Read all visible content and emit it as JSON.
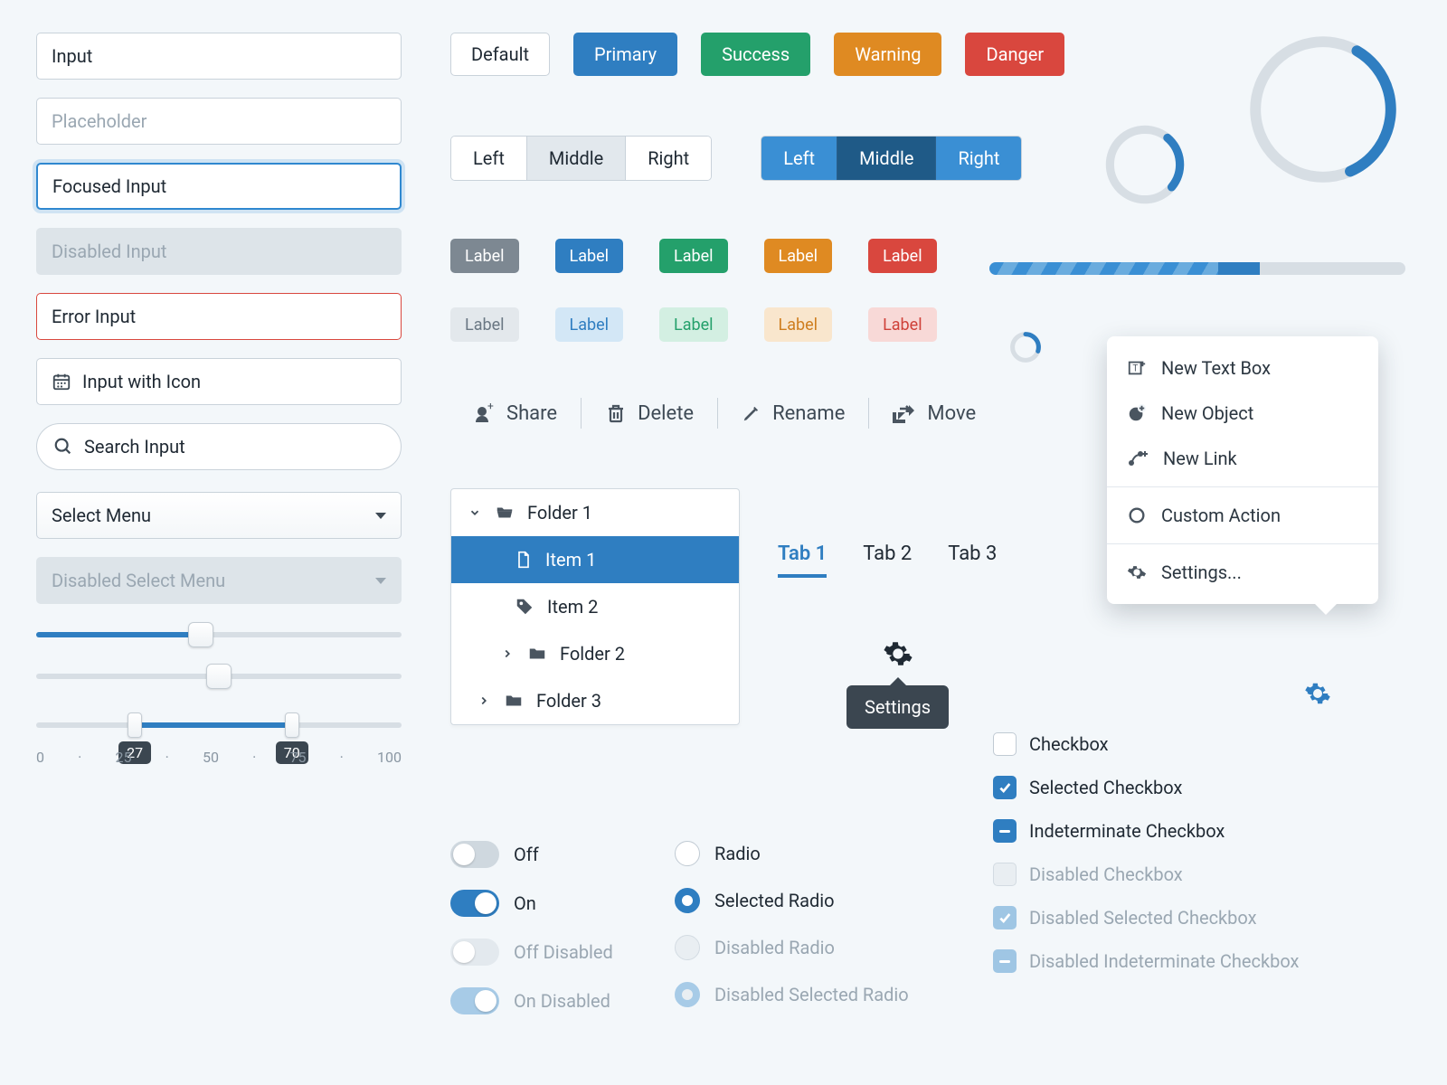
{
  "inputs": {
    "value": "Input",
    "placeholder": "Placeholder",
    "focused": "Focused Input",
    "disabled": "Disabled Input",
    "error": "Error Input",
    "withIcon": "Input with Icon",
    "search": "Search Input",
    "select": "Select Menu",
    "selectDisabled": "Disabled Select Menu"
  },
  "buttons": {
    "default": "Default",
    "primary": "Primary",
    "success": "Success",
    "warning": "Warning",
    "danger": "Danger"
  },
  "seg": {
    "left": "Left",
    "middle": "Middle",
    "right": "Right"
  },
  "tag": "Label",
  "actions": {
    "share": "Share",
    "delete": "Delete",
    "rename": "Rename",
    "move": "Move"
  },
  "tree": {
    "folder1": "Folder 1",
    "item1": "Item 1",
    "item2": "Item 2",
    "folder2": "Folder 2",
    "folder3": "Folder 3"
  },
  "tabs": {
    "t1": "Tab 1",
    "t2": "Tab 2",
    "t3": "Tab 3"
  },
  "tooltip": "Settings",
  "menu": {
    "newText": "New Text Box",
    "newObject": "New Object",
    "newLink": "New Link",
    "custom": "Custom Action",
    "settings": "Settings..."
  },
  "checks": {
    "cb": "Checkbox",
    "sel": "Selected Checkbox",
    "ind": "Indeterminate Checkbox",
    "dis": "Disabled Checkbox",
    "disSel": "Disabled Selected Checkbox",
    "disInd": "Disabled Indeterminate Checkbox"
  },
  "toggles": {
    "off": "Off",
    "on": "On",
    "offDis": "Off Disabled",
    "onDis": "On Disabled"
  },
  "radios": {
    "r": "Radio",
    "sel": "Selected Radio",
    "dis": "Disabled Radio",
    "disSel": "Disabled Selected Radio"
  },
  "slider": {
    "single": 45,
    "center": 50
  },
  "range": {
    "low": 27,
    "high": 70,
    "ticks": [
      "0",
      "·",
      "25",
      "·",
      "50",
      "·",
      "75",
      "·",
      "100"
    ],
    "lowLabel": "27",
    "highLabel": "70"
  },
  "progress": {
    "striped": 55,
    "extra": 10,
    "ringLarge": 35,
    "ringMed": 25,
    "ringSmall": 30
  }
}
